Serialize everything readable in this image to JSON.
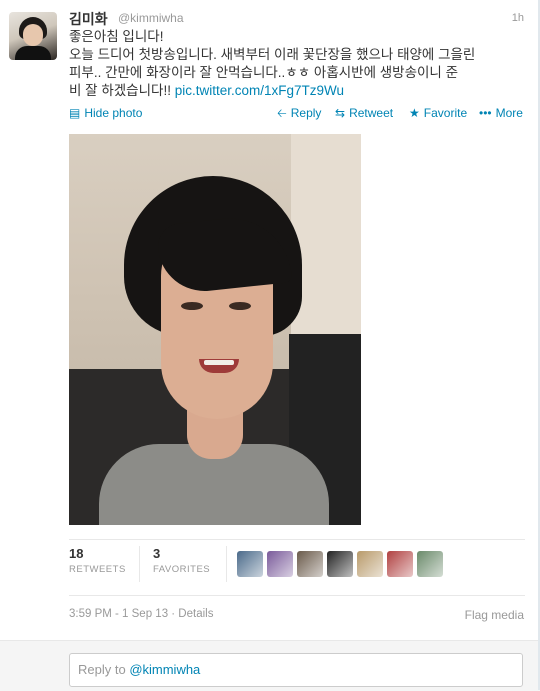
{
  "tweet": {
    "name": "김미화",
    "handle": "@kimmiwha",
    "time": "1h",
    "text_line1": "좋은아침 입니다!",
    "text_line2": "오늘 드디어 첫방송입니다. 새벽부터 이래 꽃단장을 했으나 태양에 그을린",
    "text_line3": "피부.. 간만에 화장이라 잘 안먹습니다..ㅎㅎ 아홉시반에 생방송이니 준",
    "text_line4": "비 잘 하겠습니다!! ",
    "link": "pic.twitter.com/1xFg7Tz9Wu"
  },
  "actions": {
    "hide_photo": "Hide photo",
    "reply": "Reply",
    "retweet": "Retweet",
    "favorite": "Favorite",
    "more": "More"
  },
  "icons": {
    "photo": "photo-icon",
    "reply": "reply-arrow-icon",
    "retweet": "retweet-icon",
    "favorite": "star-icon",
    "more": "ellipsis-icon"
  },
  "stats": {
    "retweets_count": "18",
    "retweets_label": "RETWEETS",
    "favorites_count": "3",
    "favorites_label": "FAVORITES"
  },
  "favoriters": [
    {
      "name": "egg-avatar",
      "color": "#4a6a8a"
    },
    {
      "name": "flowers-avatar",
      "color": "#7a5a9a"
    },
    {
      "name": "group-avatar",
      "color": "#6a5a4a"
    },
    {
      "name": "portrait-avatar",
      "color": "#222222"
    },
    {
      "name": "man-avatar",
      "color": "#b89a6a"
    },
    {
      "name": "red-avatar",
      "color": "#b04040"
    },
    {
      "name": "landscape-avatar",
      "color": "#6a8a6a"
    }
  ],
  "meta": {
    "timestamp": "3:59 PM - 1 Sep 13 · Details",
    "flag_media": "Flag media"
  },
  "reply_box": {
    "prefix": "Reply to ",
    "mention": "@kimmiwha"
  },
  "colors": {
    "link": "#0084b4",
    "muted": "#999999",
    "text": "#333333"
  }
}
